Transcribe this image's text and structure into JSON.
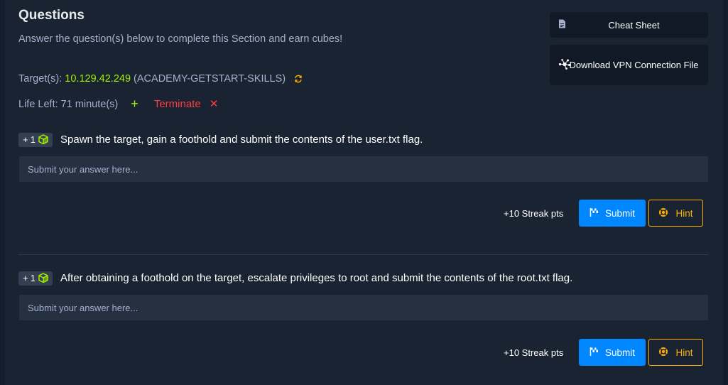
{
  "header": {
    "title": "Questions",
    "subtitle": "Answer the question(s) below to complete this Section and earn cubes!"
  },
  "target": {
    "label": "Target(s):",
    "ip": "10.129.42.249",
    "name": "(ACADEMY-GETSTART-SKILLS)"
  },
  "life": {
    "label": "Life Left: 71 minute(s)",
    "terminate_label": "Terminate"
  },
  "sidebar": {
    "cheat_sheet_label": "Cheat Sheet",
    "vpn_label": "Download VPN Connection File"
  },
  "questions": [
    {
      "badge": "+ 1",
      "text": "Spawn the target, gain a foothold and submit the contents of the user.txt flag.",
      "placeholder": "Submit your answer here...",
      "streak": "+10 Streak pts",
      "submit_label": "Submit",
      "hint_label": "Hint"
    },
    {
      "badge": "+ 1",
      "text": "After obtaining a foothold on the target, escalate privileges to root and submit the contents of the root.txt flag.",
      "placeholder": "Submit your answer here...",
      "streak": "+10 Streak pts",
      "submit_label": "Submit",
      "hint_label": "Hint"
    }
  ],
  "colors": {
    "background": "#141d2b",
    "panel": "#1a2332",
    "accent_green": "#9fef00",
    "accent_blue": "#0086ff",
    "accent_orange": "#ffaf00",
    "danger_red": "#ff3e3e",
    "muted_text": "#a4b1cd"
  },
  "icons": {
    "refresh": "refresh-icon",
    "plus": "plus-icon",
    "close": "x-icon",
    "document": "document-icon",
    "network": "network-icon",
    "cube": "cube-icon",
    "flag": "flag-icon",
    "hint": "hint-icon"
  }
}
